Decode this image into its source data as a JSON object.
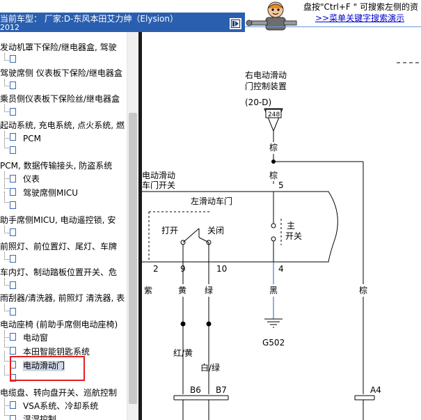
{
  "header": {
    "vehicle_label": "当前车型： 厂家:D-东风本田艾力绅（Elysion）",
    "vehicle_year": "2012",
    "hint": "盘按\"Ctrl+F \" 可搜索左侧的资",
    "link": ">>菜单关键字搜索演示"
  },
  "tree": {
    "items": [
      {
        "label": "发动机罩下保险/继电器盒, 驾驶"
      },
      {
        "label": "驾驶席侧 仪表板下保险/继电器盒"
      },
      {
        "label": "乘员侧仪表板下保险丝/继电器盒"
      },
      {
        "label": "起动系统, 充电系统, 点火系统, 燃"
      },
      {
        "label": "PCM"
      },
      {
        "label": "PCM, 数据传输接头, 防盗系统"
      },
      {
        "label": "仪表"
      },
      {
        "label": "驾驶席侧MICU"
      },
      {
        "label": "助手席侧MICU, 电动遥控锁, 安"
      },
      {
        "label": "前照灯、前位置灯、尾灯、车牌"
      },
      {
        "label": "车内灯、制动踏板位置开关、危"
      },
      {
        "label": "雨刮器/清洗器, 前照灯 清洗器, 表"
      },
      {
        "label": "电动座椅 (前助手席侧电动座椅)"
      },
      {
        "label": "电动窗"
      },
      {
        "label": "本田智能钥匙系统"
      },
      {
        "label": "电动滑动门"
      },
      {
        "label": "电缆盘、转向盘开关、巡航控制"
      },
      {
        "label": "VSA系统、冷却系统"
      },
      {
        "label": "温湿控制"
      }
    ]
  },
  "diagram": {
    "right_unit": "右电动滑动",
    "right_unit2": "门控制装置",
    "right_code": "(20-D)",
    "pin_248": "248",
    "wire_brown1": "棕",
    "wire_brown2": "棕",
    "wire_brown3": "棕",
    "left_switch1": "电动滑动",
    "left_switch2": "车门开关",
    "pin_5": "5",
    "left_door": "左滑动车门",
    "open": "打开",
    "close": "关闭",
    "main": "主",
    "switch": "开关",
    "pin_2": "2",
    "pin_9": "9",
    "pin_10": "10",
    "pin_4": "4",
    "wire_purple": "紫",
    "wire_yellow": "黄",
    "wire_green": "绿",
    "wire_black": "黑",
    "ground": "G502",
    "wire_red_yellow": "红/黄",
    "wire_white_green": "白/绿",
    "conn_b6": "B6",
    "conn_b7": "B7",
    "conn_a4": "A4"
  }
}
